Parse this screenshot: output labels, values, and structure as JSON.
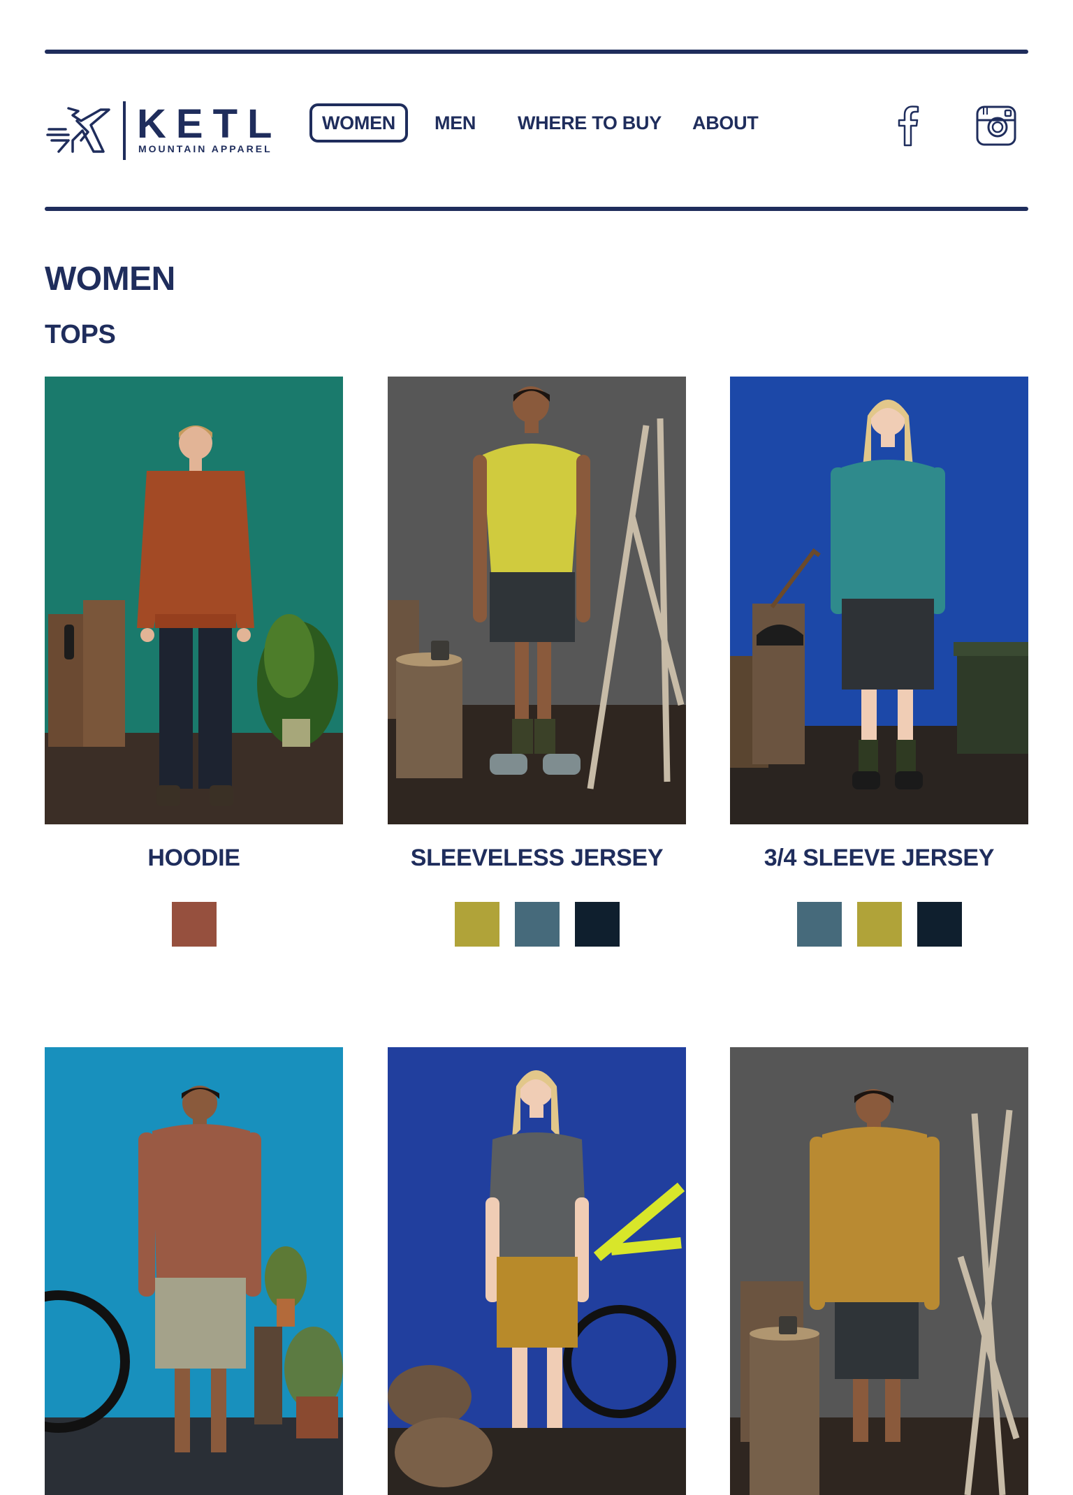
{
  "brand": {
    "name": "KETL",
    "tagline": "MOUNTAIN APPAREL",
    "navy": "#1f2d5c"
  },
  "nav": {
    "items": [
      {
        "label": "WOMEN",
        "active": true
      },
      {
        "label": "MEN",
        "active": false
      },
      {
        "label": "WHERE TO BUY",
        "active": false
      },
      {
        "label": "ABOUT",
        "active": false
      }
    ]
  },
  "social": [
    {
      "icon": "facebook-icon"
    },
    {
      "icon": "instagram-icon"
    }
  ],
  "page": {
    "title": "WOMEN",
    "section": "TOPS"
  },
  "products": [
    {
      "name": "HOODIE",
      "background": "#1a7a6c",
      "colors": [
        "#96503e"
      ]
    },
    {
      "name": "SLEEVELESS JERSEY",
      "background": "#575757",
      "colors": [
        "#b0a339",
        "#466a7b",
        "#0f1f2e"
      ]
    },
    {
      "name": "3/4 SLEEVE JERSEY",
      "background": "#1c48a8",
      "colors": [
        "#466a7b",
        "#b0a339",
        "#0f1f2e"
      ]
    },
    {
      "name": "",
      "background": "#1890bd",
      "colors": []
    },
    {
      "name": "",
      "background": "#213f9e",
      "colors": []
    },
    {
      "name": "",
      "background": "#565656",
      "colors": []
    }
  ]
}
